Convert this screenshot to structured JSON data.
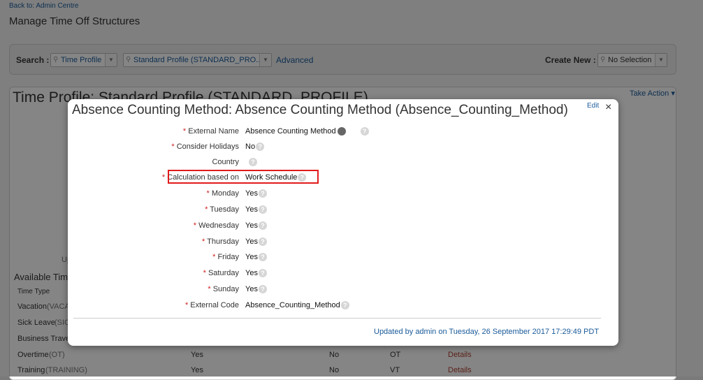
{
  "header": {
    "back_link": "Back to: Admin Centre",
    "title": "Manage Time Off Structures"
  },
  "search": {
    "label": "Search :",
    "type_value": "Time Profile",
    "profile_value": "Standard Profile (STANDARD_PRO...",
    "advanced": "Advanced",
    "create_new_label": "Create New :",
    "create_new_value": "No Selection"
  },
  "profile": {
    "title": "Time Profile: Standard Profile (STANDARD_PROFILE)",
    "take_action": "Take Action",
    "left_label": "Up",
    "section_title": "Available Time",
    "col_time_type": "Time Type",
    "rows": [
      {
        "name": "Vacation",
        "code": "(VACA"
      },
      {
        "name": "Sick Leave",
        "code": "(SIC"
      },
      {
        "name": "Business Travel",
        "code": ""
      },
      {
        "name": "Overtime",
        "code": "(OT)",
        "v1": "Yes",
        "v2": "No",
        "v3": "OT",
        "link": "Details"
      },
      {
        "name": "Training",
        "code": "(TRAINING)",
        "v1": "Yes",
        "v2": "No",
        "v3": "VT",
        "link": "Details"
      }
    ]
  },
  "modal": {
    "title": "Absence Counting Method: Absence Counting Method (Absence_Counting_Method)",
    "edit": "Edit",
    "close": "×",
    "fields": [
      {
        "label": "External Name",
        "required": true,
        "value": "Absence Counting Method",
        "pin": true
      },
      {
        "label": "Consider Holidays",
        "required": true,
        "value": "No"
      },
      {
        "label": "Country",
        "required": false,
        "value": ""
      },
      {
        "label": "Calculation based on",
        "required": true,
        "value": "Work Schedule"
      },
      {
        "label": "Monday",
        "required": true,
        "value": "Yes"
      },
      {
        "label": "Tuesday",
        "required": true,
        "value": "Yes"
      },
      {
        "label": "Wednesday",
        "required": true,
        "value": "Yes"
      },
      {
        "label": "Thursday",
        "required": true,
        "value": "Yes"
      },
      {
        "label": "Friday",
        "required": true,
        "value": "Yes"
      },
      {
        "label": "Saturday",
        "required": true,
        "value": "Yes"
      },
      {
        "label": "Sunday",
        "required": true,
        "value": "Yes"
      },
      {
        "label": "External Code",
        "required": true,
        "value": "Absence_Counting_Method"
      }
    ],
    "updated": "Updated by admin on Tuesday, 26 September 2017 17:29:49 PDT"
  },
  "colors": {
    "highlight": "#e21b1b",
    "link": "#1a5a9a",
    "required": "#d02020"
  }
}
